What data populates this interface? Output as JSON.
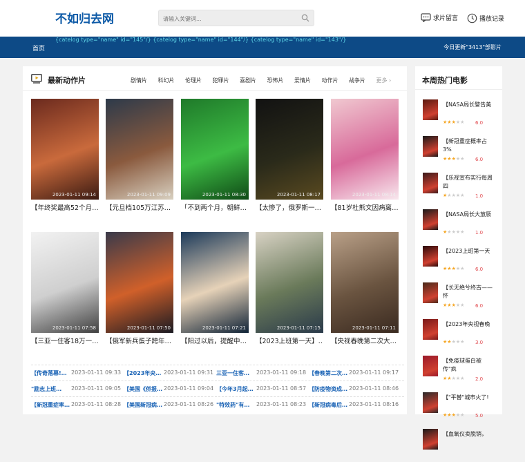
{
  "header": {
    "logo": "不如归去网",
    "search_placeholder": "请输入关键词...",
    "link_request": "求片留言",
    "link_history": "播放记录"
  },
  "nav": {
    "home": "首页",
    "template_text": "{catelog type=\"name\" id=\"145\"/} {catelog type=\"name\" id=\"144\"/} {catelog type=\"name\" id=\"143\"/}",
    "today": "今日更新\"3413\"部影片"
  },
  "section": {
    "title": "最新动作片",
    "categories": [
      "剧情片",
      "科幻片",
      "伦理片",
      "犯罪片",
      "喜剧片",
      "恐怖片",
      "爱情片",
      "动作片",
      "战争片"
    ],
    "more": "更多"
  },
  "cards": [
    {
      "title": "【年终奖最高52个月…",
      "time": "2023-01-11 09:14",
      "colors": [
        "#6b2a1e",
        "#c96a3c",
        "#3a1a12"
      ]
    },
    {
      "title": "【元旦档105万江苏…",
      "time": "2023-01-11 09:09",
      "colors": [
        "#2d3a4a",
        "#8a5a3e",
        "#d8d0c0"
      ]
    },
    {
      "title": "「不到两个月，朝鲜…",
      "time": "2023-01-11 08:30",
      "colors": [
        "#1f7a2a",
        "#3dbb44",
        "#0f4a16"
      ]
    },
    {
      "title": "【太惨了，俄罗斯一…",
      "time": "2023-01-11 08:17",
      "colors": [
        "#121212",
        "#2a2a1a",
        "#5a4a20"
      ]
    },
    {
      "title": "【81岁杜熊文因病离…",
      "time": "2023-01-11 08:14",
      "colors": [
        "#f0c8d0",
        "#d86a9a",
        "#f8e8ee"
      ]
    },
    {
      "title": "【三亚一住客18万一…",
      "time": "2023-01-11 07:58",
      "colors": [
        "#f2f2f2",
        "#cfcfcf",
        "#404040"
      ]
    },
    {
      "title": "【俄军新兵蛋子跨年…",
      "time": "2023-01-11 07:50",
      "colors": [
        "#3a3a4a",
        "#d0602a",
        "#1a1a22"
      ]
    },
    {
      "title": "【阳过以后，提醒中…",
      "time": "2023-01-11 07:21",
      "colors": [
        "#1c3a5a",
        "#e6d2b8",
        "#0f2236"
      ]
    },
    {
      "title": "【2023上班第一天】…",
      "time": "2023-01-11 07:15",
      "colors": [
        "#d8d2c4",
        "#6a7a5a",
        "#2a3a4a"
      ]
    },
    {
      "title": "【央视春晚第二次大…",
      "time": "2023-01-11 07:11",
      "colors": [
        "#b9a088",
        "#6a5440",
        "#3a2a20"
      ]
    }
  ],
  "news": [
    [
      {
        "title": "【传奇落幕!…",
        "date": "2023-01-11 09:33"
      },
      {
        "title": "【2023年央…",
        "date": "2023-01-11 09:31"
      },
      {
        "title": "三亚一住客…",
        "date": "2023-01-11 09:18"
      },
      {
        "title": "【春晚第二次…",
        "date": "2023-01-11 09:17"
      }
    ],
    [
      {
        "title": "\"励志上班…",
        "date": "2023-01-11 09:05"
      },
      {
        "title": "【美国《侨报…",
        "date": "2023-01-11 09:04"
      },
      {
        "title": "【今年3月起…",
        "date": "2023-01-11 08:57"
      },
      {
        "title": "【防疫物资成…",
        "date": "2023-01-11 08:46"
      }
    ],
    [
      {
        "title": "【新冠重症率…",
        "date": "2023-01-11 08:28"
      },
      {
        "title": "【美国新冠病…",
        "date": "2023-01-11 08:26"
      },
      {
        "title": "\"特效药\"有…",
        "date": "2023-01-11 08:23"
      },
      {
        "title": "【新冠病毒后…",
        "date": "2023-01-11 08:16"
      }
    ]
  ],
  "sidebar": {
    "title": "本周热门电影",
    "items": [
      {
        "title": "【NASA局长警告美",
        "stars": 3,
        "score": "6.0",
        "color": "#5a1a10"
      },
      {
        "title": "【新冠重症概率占3%",
        "stars": 3,
        "score": "6.0",
        "color": "#1a1a1a"
      },
      {
        "title": "【乐视宣布实行每周四",
        "stars": 1,
        "score": "1.0",
        "color": "#3a1a1a"
      },
      {
        "title": "【NASA局长大放厥",
        "stars": 1,
        "score": "1.0",
        "color": "#1a1a1a"
      },
      {
        "title": "【2023上班第一天",
        "stars": 3,
        "score": "6.0",
        "color": "#2a0a0a"
      },
      {
        "title": "【长无绝兮终古——怀",
        "stars": 3,
        "score": "6.0",
        "color": "#4a2a1a"
      },
      {
        "title": "【2023年央视春晚",
        "stars": 2,
        "score": "3.0",
        "color": "#7a1a1a"
      },
      {
        "title": "【免疫球蛋白被传\"疯",
        "stars": 2,
        "score": "2.0",
        "color": "#9a1a2a"
      },
      {
        "title": "【\"平替\"城市火了!",
        "stars": 3,
        "score": "5.0",
        "color": "#2a2a2a"
      },
      {
        "title": "【血氧仪卖脱销，",
        "stars": 0,
        "score": "",
        "color": "#1a1a1a"
      }
    ]
  }
}
